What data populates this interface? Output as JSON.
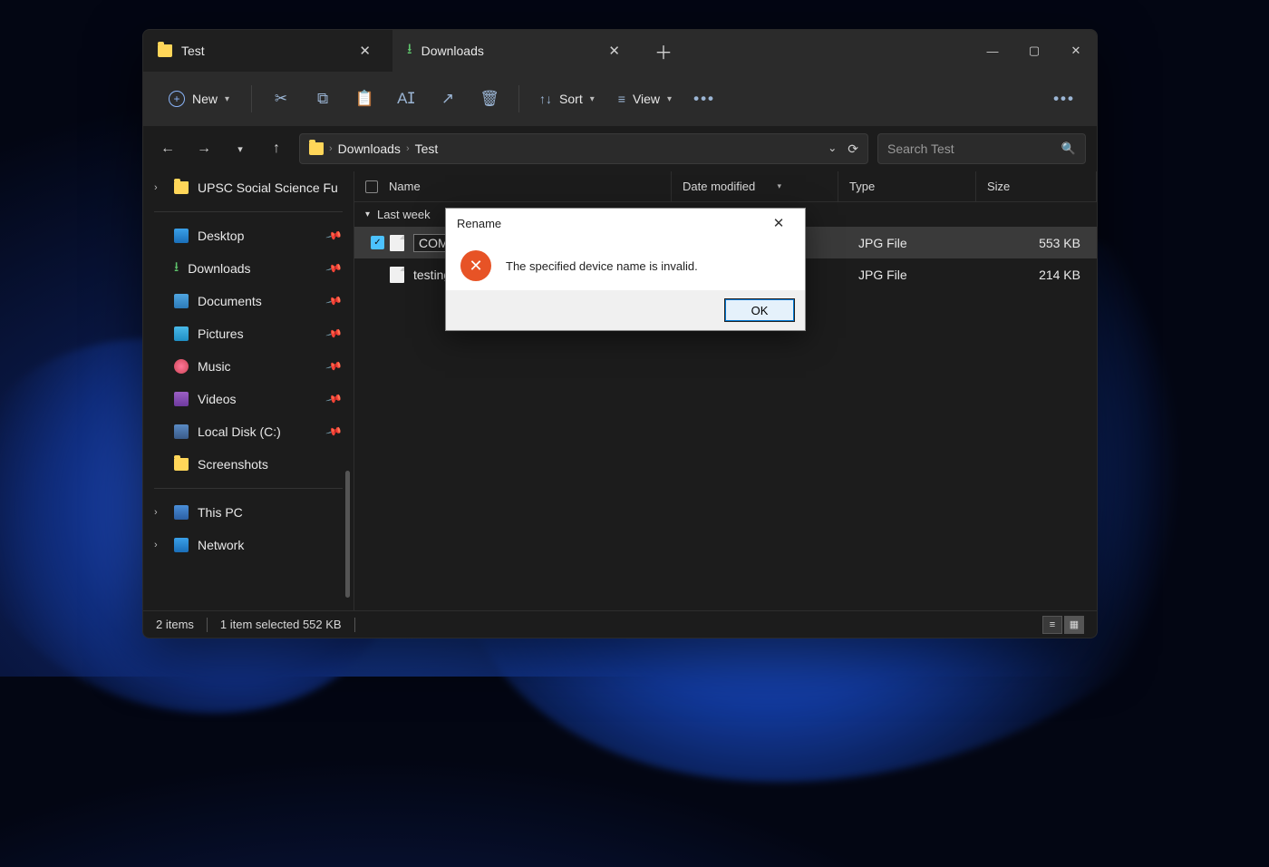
{
  "tabs": [
    {
      "label": "Test",
      "icon": "folder"
    },
    {
      "label": "Downloads",
      "icon": "download"
    }
  ],
  "active_tab": 0,
  "toolbar": {
    "new_label": "New",
    "sort_label": "Sort",
    "view_label": "View"
  },
  "breadcrumb": {
    "segments": [
      "Downloads",
      "Test"
    ]
  },
  "search": {
    "placeholder": "Search Test"
  },
  "sidebar": {
    "tree_item": "UPSC Social Science Fu",
    "quick": [
      {
        "label": "Desktop",
        "pinned": true,
        "iconClass": "desk-i"
      },
      {
        "label": "Downloads",
        "pinned": true,
        "iconClass": "dl-i",
        "iconType": "glyph"
      },
      {
        "label": "Documents",
        "pinned": true,
        "iconClass": "doc-i"
      },
      {
        "label": "Pictures",
        "pinned": true,
        "iconClass": "pic-i"
      },
      {
        "label": "Music",
        "pinned": true,
        "iconClass": "mus-i"
      },
      {
        "label": "Videos",
        "pinned": true,
        "iconClass": "vid-i"
      },
      {
        "label": "Local Disk (C:)",
        "pinned": true,
        "iconClass": "disk-i"
      },
      {
        "label": "Screenshots",
        "pinned": false,
        "iconClass": "folder"
      }
    ],
    "sections": [
      {
        "label": "This PC",
        "iconClass": "pc-i"
      },
      {
        "label": "Network",
        "iconClass": "net-i"
      }
    ]
  },
  "columns": {
    "name": "Name",
    "date": "Date modified",
    "type": "Type",
    "size": "Size"
  },
  "group": "Last week",
  "files": [
    {
      "name": "COM1",
      "date": "",
      "type": "JPG File",
      "size": "553 KB",
      "selected": true,
      "editing": true
    },
    {
      "name": "testing",
      "date": "",
      "type": "JPG File",
      "size": "214 KB",
      "selected": false,
      "editing": false
    }
  ],
  "statusbar": {
    "items_count": "2 items",
    "selected": "1 item selected  552 KB"
  },
  "dialog": {
    "title": "Rename",
    "message": "The specified device name is invalid.",
    "ok": "OK"
  }
}
